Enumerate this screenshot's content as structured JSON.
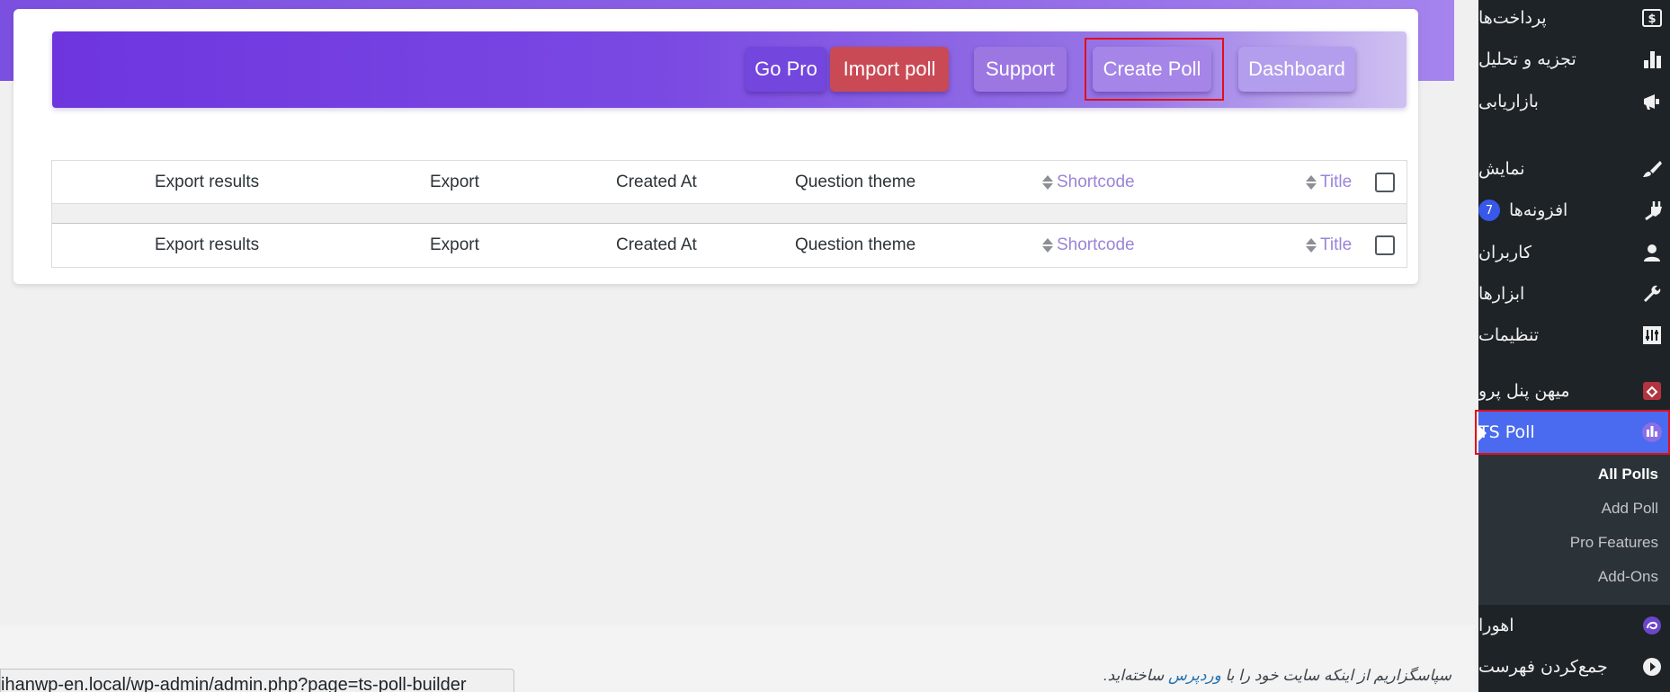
{
  "header": {
    "buttons": {
      "go_pro": "Go Pro",
      "import_poll": "Import poll",
      "support": "Support",
      "create_poll": "Create Poll",
      "dashboard": "Dashboard"
    }
  },
  "table": {
    "columns": {
      "export_results": "Export results",
      "export": "Export",
      "created_at": "Created At",
      "question_theme": "Question theme",
      "shortcode": "Shortcode",
      "title": "Title"
    }
  },
  "footer": {
    "text_prefix": "سپاسگزاریم از اینکه سایت خود را با ",
    "link": "وردپرس",
    "text_suffix": " ساخته‌اید.",
    "status_url": "ihanwp-en.local/wp-admin/admin.php?page=ts-poll-builder"
  },
  "sidebar": {
    "items": [
      {
        "label": "پرداخت‌ها",
        "icon": "dollar-icon"
      },
      {
        "label": "تجزیه و تحلیل",
        "icon": "bar-chart-icon"
      },
      {
        "label": "بازاریابی",
        "icon": "megaphone-icon"
      },
      {
        "label": "نمایش",
        "icon": "brush-icon"
      },
      {
        "label": "افزونه‌ها",
        "icon": "plugin-icon",
        "badge": "7"
      },
      {
        "label": "کاربران",
        "icon": "user-icon"
      },
      {
        "label": "ابزارها",
        "icon": "wrench-icon"
      },
      {
        "label": "تنظیمات",
        "icon": "settings-icon"
      },
      {
        "label": "میهن پنل پرو",
        "icon": "mihan-panel-icon"
      },
      {
        "label": "TS Poll",
        "icon": "ts-poll-icon"
      },
      {
        "label": "اهورا",
        "icon": "ahura-icon"
      },
      {
        "label": "جمع‌کردن فهرست",
        "icon": "collapse-icon"
      }
    ],
    "submenu": {
      "all_polls": "All Polls",
      "add_poll": "Add Poll",
      "pro_features": "Pro Features",
      "add_ons": "Add-Ons"
    }
  },
  "colors": {
    "accent": "#6e35df",
    "import_button": "#c94a55",
    "sidebar_bg": "#1d2327",
    "active_menu": "#4a6bef",
    "highlight": "#e10f1a"
  }
}
